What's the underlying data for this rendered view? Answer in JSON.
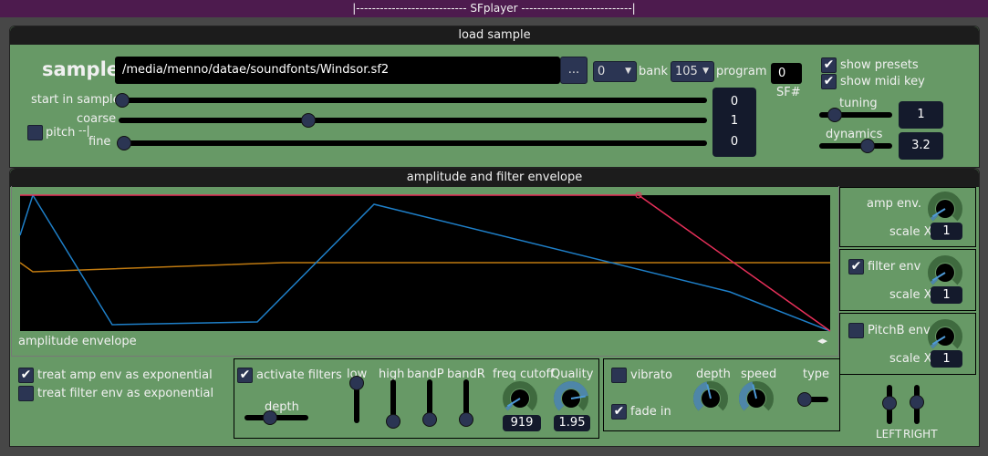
{
  "title": "|---------------------------- SFplayer ----------------------------|",
  "load": {
    "header": "load sample",
    "sample_label": "sample",
    "path": "/media/menno/datae/soundfonts/Windsor.sf2",
    "browse": "...",
    "bank_value": "0",
    "bank_label": "bank",
    "program_value": "105",
    "program_label": "program",
    "sf_value": "0",
    "sf_label": "SF#",
    "show_presets": "show presets",
    "show_presets_checked": true,
    "show_midi_key": "show midi key",
    "show_midi_key_checked": true,
    "start_label": "start in sample",
    "start_value": "0",
    "start_level": 0,
    "coarse_label": "coarse",
    "coarse_value": "1",
    "coarse_level": 0.34,
    "fine_label": "fine",
    "fine_value": "0",
    "fine_level": 0,
    "pitch_label": "pitch",
    "pitch_checked": false,
    "pitch_bracket": "--|",
    "tuning_label": "tuning",
    "tuning_value": "1",
    "dynamics_label": "dynamics",
    "dynamics_value": "3.2"
  },
  "envelope": {
    "header": "amplitude and filter envelope",
    "graph_label": "amplitude envelope",
    "arrows": "◂▸",
    "colors": {
      "amp": "#e8305a",
      "filter": "#1e7fc8",
      "pitch": "#c07a10"
    },
    "amp_env": "amp env.",
    "amp_scale_label": "scale X",
    "amp_scale": "1",
    "filter_env": "filter env",
    "filter_env_checked": true,
    "filter_scale_label": "scale X",
    "filter_scale": "1",
    "pitch_env": "PitchB env.",
    "pitch_env_checked": false,
    "pitch_scale_label": "scale X",
    "pitch_scale": "1"
  },
  "options": {
    "amp_exp": "treat amp env as exponential",
    "amp_exp_checked": true,
    "filter_exp": "treat filter env as exponential",
    "filter_exp_checked": false
  },
  "filters": {
    "activate": "activate filters",
    "activate_checked": true,
    "depth": "depth",
    "low": "low",
    "high": "high",
    "bandP": "bandP",
    "bandR": "bandR",
    "freq_label": "freq cutoff",
    "freq_value": "919",
    "quality_label": "Quality",
    "quality_value": "1.95"
  },
  "vibrato": {
    "vibrato": "vibrato",
    "vibrato_checked": false,
    "fade_in": "fade in",
    "fade_in_checked": true,
    "depth": "depth",
    "speed": "speed",
    "type": "type"
  },
  "output": {
    "left": "LEFT",
    "right": "RIGHT"
  }
}
